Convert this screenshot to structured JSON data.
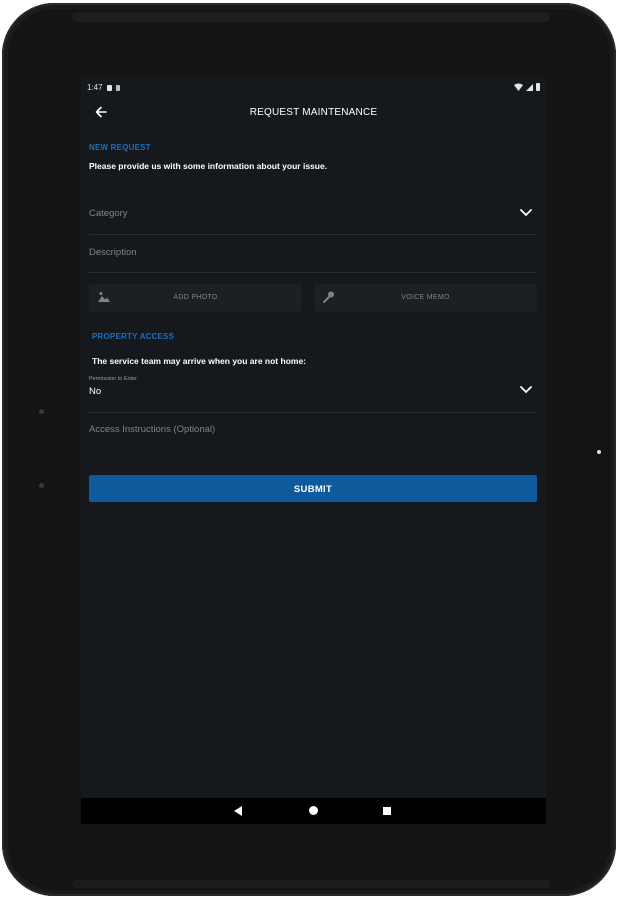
{
  "status_bar": {
    "time": "1:47"
  },
  "app_bar": {
    "title": "REQUEST MAINTENANCE"
  },
  "new_request": {
    "section_title": "NEW REQUEST",
    "info_text": "Please provide us with some information about your issue.",
    "category_placeholder": "Category",
    "description_placeholder": "Description",
    "add_photo_label": "ADD PHOTO",
    "voice_memo_label": "VOICE MEMO"
  },
  "property_access": {
    "section_title": "PROPERTY ACCESS",
    "info_text": "The service team may arrive when you are not home:",
    "permission_label": "Permission to Enter",
    "permission_value": "No",
    "instructions_placeholder": "Access Instructions (Optional)"
  },
  "submit_label": "SUBMIT",
  "colors": {
    "accent": "#1f6fb8",
    "submit": "#0e5a9c",
    "screen_bg": "#15191d"
  }
}
